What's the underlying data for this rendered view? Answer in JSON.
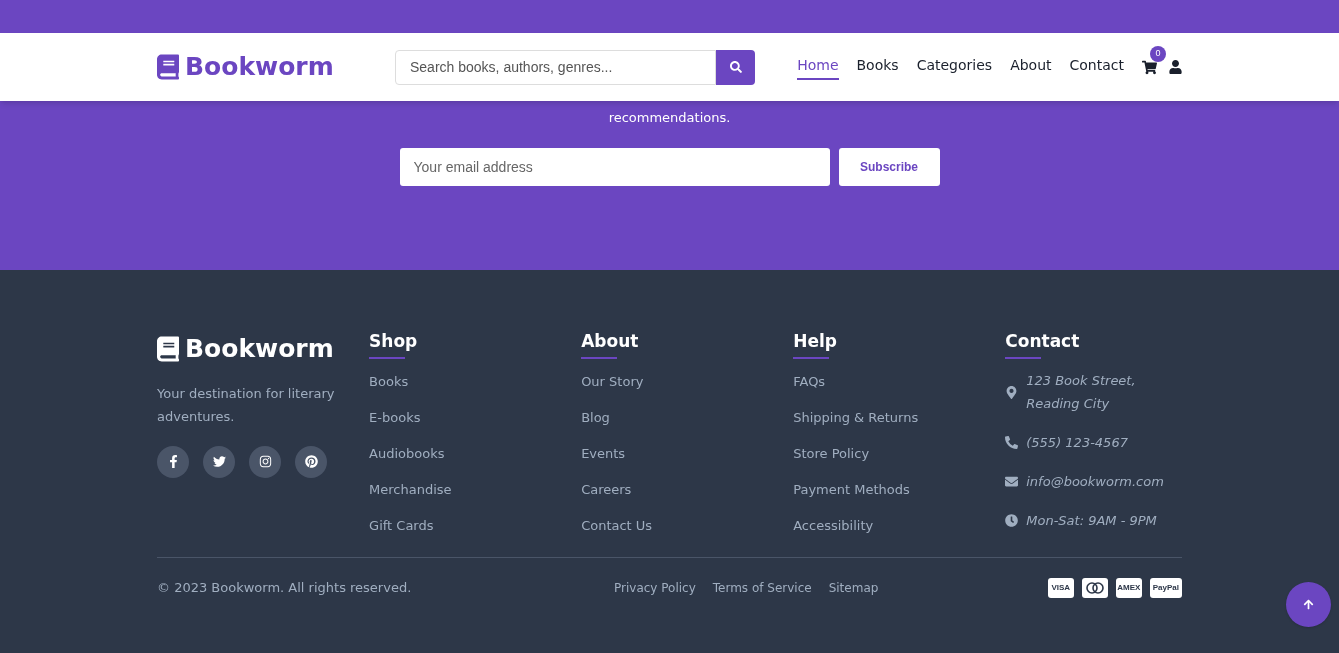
{
  "newsletter": {
    "text_visible": "recommendations.",
    "email_placeholder": "Your email address",
    "button": "Subscribe"
  },
  "header": {
    "logo": "Bookworm",
    "search_placeholder": "Search books, authors, genres...",
    "nav": [
      {
        "label": "Home",
        "selected": true
      },
      {
        "label": "Books",
        "selected": false
      },
      {
        "label": "Categories",
        "selected": false
      },
      {
        "label": "About",
        "selected": false
      },
      {
        "label": "Contact",
        "selected": false
      }
    ],
    "cart_count": "0"
  },
  "footer": {
    "logo": "Bookworm",
    "tagline": "Your destination for literary adventures.",
    "social": [
      {
        "kind": "facebook"
      },
      {
        "kind": "twitter"
      },
      {
        "kind": "instagram"
      },
      {
        "kind": "pinterest"
      }
    ],
    "columns": [
      {
        "title": "Shop",
        "links": [
          "Books",
          "E-books",
          "Audiobooks",
          "Merchandise",
          "Gift Cards"
        ]
      },
      {
        "title": "About",
        "links": [
          "Our Story",
          "Blog",
          "Events",
          "Careers",
          "Contact Us"
        ]
      },
      {
        "title": "Help",
        "links": [
          "FAQs",
          "Shipping & Returns",
          "Store Policy",
          "Payment Methods",
          "Accessibility"
        ]
      }
    ],
    "contact": {
      "title": "Contact",
      "items": [
        {
          "kind": "address",
          "text": "123 Book Street, Reading City"
        },
        {
          "kind": "phone",
          "text": "(555) 123-4567"
        },
        {
          "kind": "email",
          "text": "info@bookworm.com"
        },
        {
          "kind": "hours",
          "text": "Mon-Sat: 9AM - 9PM"
        }
      ]
    },
    "copyright": "© 2023 Bookworm. All rights reserved.",
    "legal_links": [
      "Privacy Policy",
      "Terms of Service",
      "Sitemap"
    ],
    "payments": [
      {
        "kind": "visa",
        "label": "VISA"
      },
      {
        "kind": "mastercard"
      },
      {
        "kind": "amex",
        "label": "AMEX"
      },
      {
        "kind": "paypal",
        "label": "PayPal"
      }
    ]
  }
}
